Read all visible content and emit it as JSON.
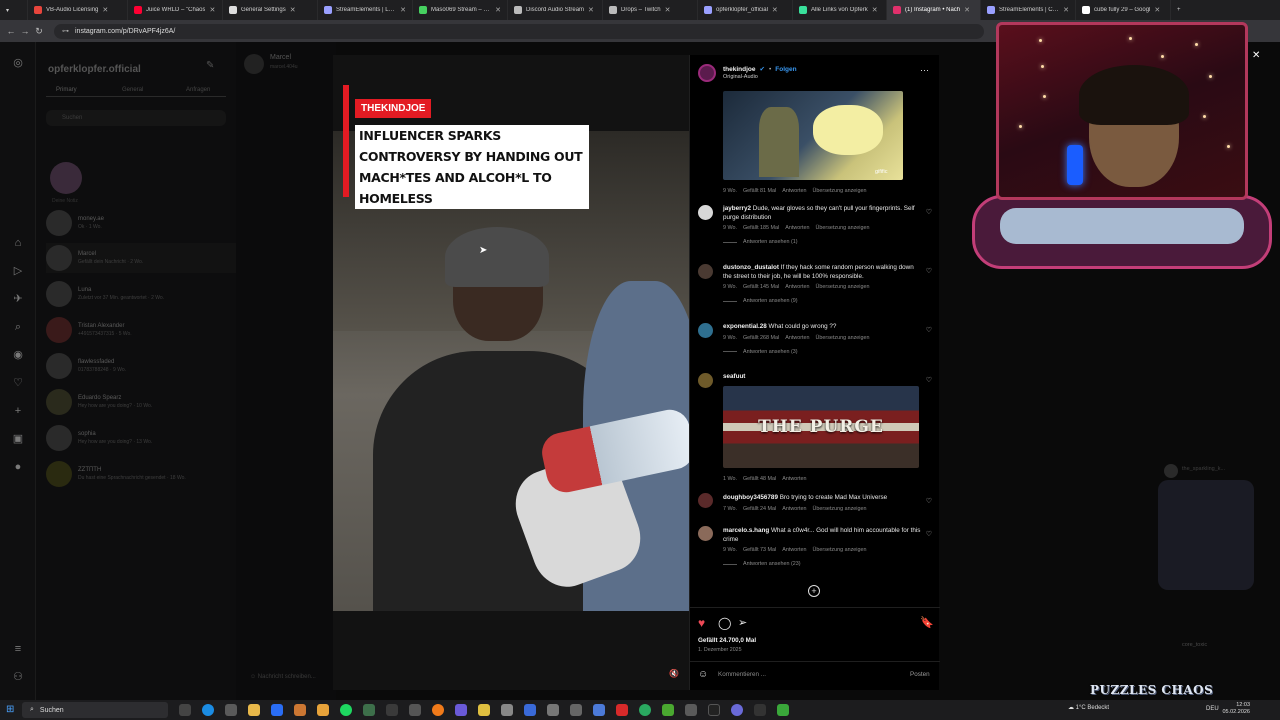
{
  "browser": {
    "tabs": [
      {
        "label": "VB-Audio Licensing",
        "color": "#e8453c"
      },
      {
        "label": "Juice WRLD – \"Chaos",
        "color": "#ff0033"
      },
      {
        "label": "General Settings",
        "color": "#dddddd"
      },
      {
        "label": "StreamElements | Late",
        "color": "#9aa0ff"
      },
      {
        "label": "Maso069 Stream – Wo",
        "color": "#46d160"
      },
      {
        "label": "Discord Audio Stream",
        "color": "#bbbbbb"
      },
      {
        "label": "Drops – Twitch",
        "color": "#bbbbbb"
      },
      {
        "label": "opferklopfer_official",
        "color": "#9aa0ff"
      },
      {
        "label": "Alle Links von Opferk",
        "color": "#39e09b"
      },
      {
        "label": "(1) Instagram • Nach",
        "color": "#e1306c"
      },
      {
        "label": "StreamElements | Con",
        "color": "#9aa0ff"
      },
      {
        "label": "cube fully 29 – Googl",
        "color": "#ffffff"
      }
    ],
    "url": "instagram.com/p/DRvAPF4jz6A/"
  },
  "dm": {
    "account": "opferklopfer.official",
    "tabs": [
      "Primary",
      "General",
      "Anfragen"
    ],
    "search_placeholder": "Suchen",
    "note": "Deine Notiz",
    "conversations": [
      {
        "name": "money.ae",
        "sub": "Ok · 1 Wo."
      },
      {
        "name": "Marcel",
        "sub": "Gefällt dein Nachricht · 2 Wo."
      },
      {
        "name": "Luna",
        "sub": "Zuletzt vor 37 Min. geantwortet · 2 Wo."
      },
      {
        "name": "Tristan Alexander",
        "sub": "+491573437315 · 5 Wo."
      },
      {
        "name": "flawlessfaded",
        "sub": "01783788248 · 9 Wo."
      },
      {
        "name": "Eduardo Spearz",
        "sub": "Hey how are you doing? · 10 Wo."
      },
      {
        "name": "sophia",
        "sub": "Hey how are you doing? · 13 Wo."
      },
      {
        "name": "ZZTПТН",
        "sub": "Du hast eine Sprachnachricht gesendet · 18 Wo."
      }
    ],
    "chat_name": "Marcel",
    "chat_sub": "marcel.404u",
    "composer": "Nachricht schreiben..."
  },
  "post": {
    "badge": "THEKINDJOE",
    "headline": "INFLUENCER SPARKS CONTROVERSY BY HANDING OUT MACH*TES AND ALCOH*L TO HOMELESS",
    "author": "thekindjoe",
    "follow": "Folgen",
    "audio": "Original-Audio",
    "gif_caption": "gifific",
    "likes": "Gefällt 24.700,0 Mal",
    "date": "1. Dezember 2025",
    "comment_placeholder": "Kommentieren ...",
    "post_button": "Posten"
  },
  "comments": [
    {
      "meta": [
        "9 Wo.",
        "Gefällt 81 Mal",
        "Antworten",
        "Übersetzung anzeigen"
      ]
    },
    {
      "user": "jayberry2",
      "text": "Dude, wear gloves so they can't pull your fingerprints. Self purge distribution",
      "meta": [
        "9 Wo.",
        "Gefällt 185 Mal",
        "Antworten",
        "Übersetzung anzeigen"
      ],
      "replies": "Antworten ansehen (1)"
    },
    {
      "user": "dustonzo_dustalot",
      "text": "If they hack some random person walking down the street to their job, he will be 100% responsible.",
      "meta": [
        "9 Wo.",
        "Gefällt 145 Mal",
        "Antworten",
        "Übersetzung anzeigen"
      ],
      "replies": "Antworten ansehen (9)"
    },
    {
      "user": "exponential.28",
      "text": "What could go wrong ??",
      "meta": [
        "9 Wo.",
        "Gefällt 268 Mal",
        "Antworten",
        "Übersetzung anzeigen"
      ],
      "replies": "Antworten ansehen (3)"
    },
    {
      "user": "seafuut",
      "gif_text": "THE PURGE",
      "meta": [
        "1 Wo.",
        "Gefällt 48 Mal",
        "Antworten"
      ]
    },
    {
      "user": "doughboy3456789",
      "text": "Bro trying to create Mad Max Universe",
      "meta": [
        "7 Wo.",
        "Gefällt 24 Mal",
        "Antworten",
        "Übersetzung anzeigen"
      ]
    },
    {
      "user": "marcelo.s.hang",
      "text": "What a c0w4r... God will hold him accountable for this crime",
      "meta": [
        "9 Wo.",
        "Gefällt 73 Mal",
        "Antworten",
        "Übersetzung anzeigen"
      ],
      "replies": "Antworten ansehen (23)"
    }
  ],
  "overlay": {
    "right_user": "the_sparkling_k...",
    "right_user2": "core_toxic",
    "puzzles": "PUZZLES CHAOS"
  },
  "taskbar": {
    "search": "Suchen",
    "weather": "1°C Bedeckt",
    "lang": "DEU",
    "time": "12:03",
    "date": "05.02.2026"
  }
}
